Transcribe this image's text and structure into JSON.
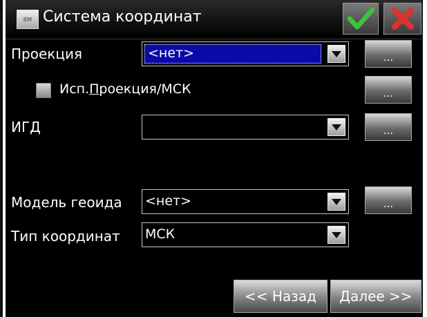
{
  "window": {
    "icon_text": "BM",
    "title": "Система координат",
    "ok_icon": "checkmark-icon",
    "cancel_icon": "close-icon"
  },
  "form": {
    "projection": {
      "label": "Проекция",
      "value": "<нет>"
    },
    "use_projection": {
      "label_prefix": "Исп.",
      "label_accel": "П",
      "label_rest": "роекция/МСК",
      "checked": false
    },
    "igd": {
      "label": "ИГД",
      "value": ""
    },
    "geoid_model": {
      "label": "Модель геоида",
      "value": "<нет>"
    },
    "coord_type": {
      "label": "Тип координат",
      "value": "МСК"
    },
    "browse_label": "..."
  },
  "nav": {
    "back_label": "<< Назад",
    "next_label": "Далее >>"
  },
  "colors": {
    "accent_selection": "#0a0aa8",
    "ok_green": "#3cc43c",
    "cancel_red": "#e03030"
  }
}
